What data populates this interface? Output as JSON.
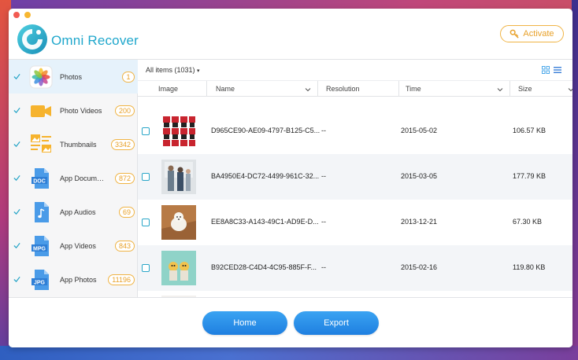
{
  "app": {
    "name": "Omni Recover",
    "activate_label": "Activate"
  },
  "sidebar": {
    "items": [
      {
        "label": "Photos",
        "count": "1",
        "icon": "photos-icon"
      },
      {
        "label": "Photo Videos",
        "count": "200",
        "icon": "video-camera-icon"
      },
      {
        "label": "Thumbnails",
        "count": "3342",
        "icon": "thumbnails-icon"
      },
      {
        "label": "App Documents",
        "count": "872",
        "icon": "doc-file-icon"
      },
      {
        "label": "App Audios",
        "count": "69",
        "icon": "audio-file-icon"
      },
      {
        "label": "App Videos",
        "count": "843",
        "icon": "mpg-file-icon"
      },
      {
        "label": "App Photos",
        "count": "11196",
        "icon": "jpg-file-icon"
      }
    ]
  },
  "main": {
    "filter_label": "All items (1031)",
    "columns": [
      "Image",
      "Name",
      "Resolution",
      "Time",
      "Size"
    ],
    "rows": [
      {
        "name": "D965CE90-AE09-4797-B125-C5...",
        "resolution": "--",
        "time": "2015-05-02",
        "size": "106.57 KB"
      },
      {
        "name": "BA4950E4-DC72-4499-961C-32...",
        "resolution": "--",
        "time": "2015-03-05",
        "size": "177.79 KB"
      },
      {
        "name": "EE8A8C33-A143-49C1-AD9E-D...",
        "resolution": "--",
        "time": "2013-12-21",
        "size": "67.30 KB"
      },
      {
        "name": "B92CED28-C4D4-4C95-885F-F...",
        "resolution": "--",
        "time": "2015-02-16",
        "size": "119.80 KB"
      }
    ]
  },
  "footer": {
    "home_label": "Home",
    "export_label": "Export"
  },
  "colors": {
    "accent": "#1fa7cc",
    "orange": "#e8a12a",
    "button": "#2a8ee8"
  }
}
